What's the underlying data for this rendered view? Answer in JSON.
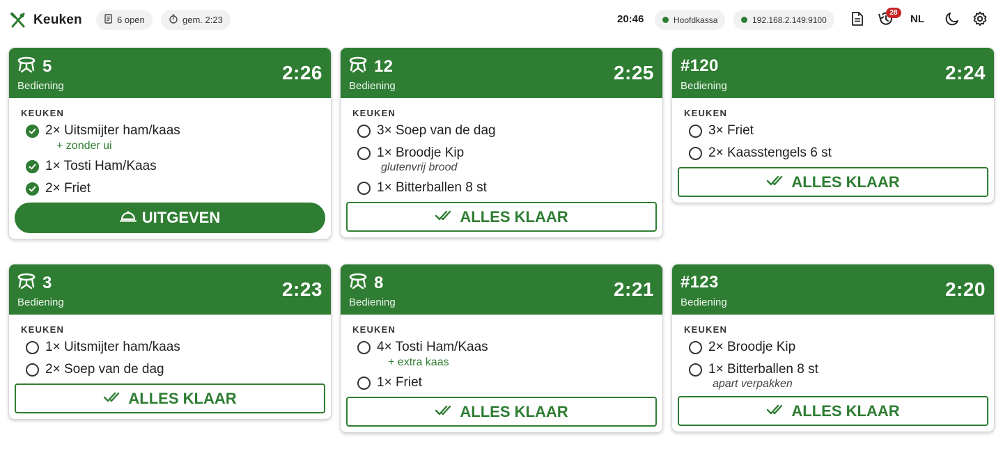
{
  "header": {
    "title": "Keuken",
    "open_count": "6 open",
    "avg_time": "gem. 2:23",
    "clock": "20:46",
    "register": "Hoofdkassa",
    "printer_ip": "192.168.2.149:9100",
    "history_badge": "28",
    "language": "NL"
  },
  "colors": {
    "accent": "#2e7d32",
    "badge": "#c62828"
  },
  "cards": [
    {
      "number": "5",
      "type": "table",
      "subtitle": "Bediening",
      "timer": "2:26",
      "section": "KEUKEN",
      "items": [
        {
          "text": "2× Uitsmijter ham/kaas",
          "done": true,
          "modifier": "+ zonder ui"
        },
        {
          "text": "1× Tosti Ham/Kaas",
          "done": true
        },
        {
          "text": "2× Friet",
          "done": true
        }
      ],
      "action": "UITGEVEN"
    },
    {
      "number": "12",
      "type": "table",
      "subtitle": "Bediening",
      "timer": "2:25",
      "section": "KEUKEN",
      "items": [
        {
          "text": "3× Soep van de dag",
          "done": false
        },
        {
          "text": "1× Broodje Kip",
          "done": false,
          "note": "glutenvrij brood"
        },
        {
          "text": "1× Bitterballen 8 st",
          "done": false
        }
      ],
      "action": "ALLES KLAAR"
    },
    {
      "number": "#120",
      "type": "order",
      "subtitle": "Bediening",
      "timer": "2:24",
      "section": "KEUKEN",
      "items": [
        {
          "text": "3× Friet",
          "done": false
        },
        {
          "text": "2× Kaasstengels 6 st",
          "done": false
        }
      ],
      "action": "ALLES KLAAR"
    },
    {
      "number": "3",
      "type": "table",
      "subtitle": "Bediening",
      "timer": "2:23",
      "section": "KEUKEN",
      "items": [
        {
          "text": "1× Uitsmijter ham/kaas",
          "done": false
        },
        {
          "text": "2× Soep van de dag",
          "done": false
        }
      ],
      "action": "ALLES KLAAR"
    },
    {
      "number": "8",
      "type": "table",
      "subtitle": "Bediening",
      "timer": "2:21",
      "section": "KEUKEN",
      "items": [
        {
          "text": "4× Tosti Ham/Kaas",
          "done": false,
          "modifier": "+ extra kaas"
        },
        {
          "text": "1× Friet",
          "done": false
        }
      ],
      "action": "ALLES KLAAR"
    },
    {
      "number": "#123",
      "type": "order",
      "subtitle": "Bediening",
      "timer": "2:20",
      "section": "KEUKEN",
      "items": [
        {
          "text": "2× Broodje Kip",
          "done": false
        },
        {
          "text": "1× Bitterballen 8 st",
          "done": false,
          "note": "apart verpakken"
        }
      ],
      "action": "ALLES KLAAR"
    }
  ]
}
